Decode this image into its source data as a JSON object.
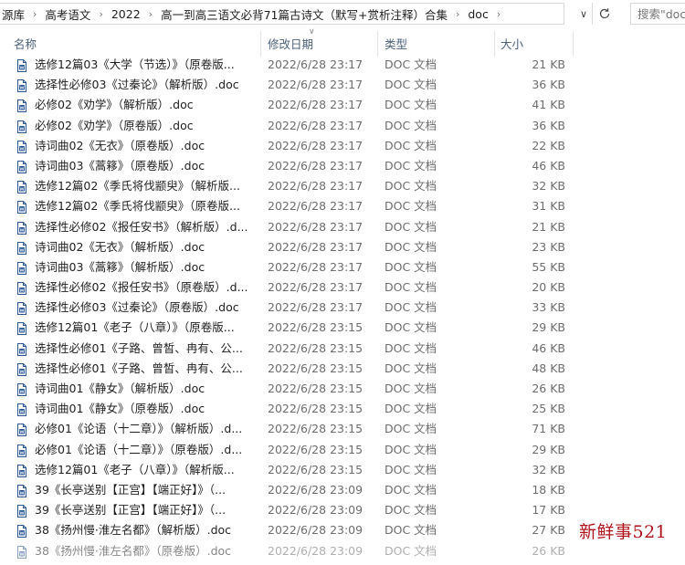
{
  "breadcrumb": [
    "源库",
    "高考语文",
    "2022",
    "高一到高三语文必背71篇古诗文（默写+赏析注释）合集",
    "doc"
  ],
  "search": {
    "placeholder": "搜索\"doc"
  },
  "columns": {
    "name": "名称",
    "date": "修改日期",
    "type": "类型",
    "size": "大小"
  },
  "files": [
    {
      "name": "选修12篇03《大学（节选）》（原卷版...",
      "date": "2022/6/28 23:17",
      "type": "DOC 文档",
      "size": "21 KB"
    },
    {
      "name": "选择性必修03《过秦论》（解析版）.doc",
      "date": "2022/6/28 23:17",
      "type": "DOC 文档",
      "size": "36 KB"
    },
    {
      "name": "必修02《劝学》（解析版）.doc",
      "date": "2022/6/28 23:17",
      "type": "DOC 文档",
      "size": "41 KB"
    },
    {
      "name": "必修02《劝学》（原卷版）.doc",
      "date": "2022/6/28 23:17",
      "type": "DOC 文档",
      "size": "36 KB"
    },
    {
      "name": "诗词曲02《无衣》（原卷版）.doc",
      "date": "2022/6/28 23:17",
      "type": "DOC 文档",
      "size": "22 KB"
    },
    {
      "name": "诗词曲03《蒿簃》（原卷版）.doc",
      "date": "2022/6/28 23:17",
      "type": "DOC 文档",
      "size": "46 KB"
    },
    {
      "name": "选修12篇02《季氏将伐颛臾》（解析版...",
      "date": "2022/6/28 23:17",
      "type": "DOC 文档",
      "size": "32 KB"
    },
    {
      "name": "选修12篇02《季氏将伐颛臾》（原卷版...",
      "date": "2022/6/28 23:17",
      "type": "DOC 文档",
      "size": "31 KB"
    },
    {
      "name": "选择性必修02《报任安书》（解析版）.d...",
      "date": "2022/6/28 23:17",
      "type": "DOC 文档",
      "size": "21 KB"
    },
    {
      "name": "诗词曲02《无衣》（解析版）.doc",
      "date": "2022/6/28 23:17",
      "type": "DOC 文档",
      "size": "23 KB"
    },
    {
      "name": "诗词曲03《蒿簃》（解析版）.doc",
      "date": "2022/6/28 23:17",
      "type": "DOC 文档",
      "size": "55 KB"
    },
    {
      "name": "选择性必修02《报任安书》（原卷版）.d...",
      "date": "2022/6/28 23:17",
      "type": "DOC 文档",
      "size": "20 KB"
    },
    {
      "name": "选择性必修03《过秦论》（原卷版）.doc",
      "date": "2022/6/28 23:17",
      "type": "DOC 文档",
      "size": "33 KB"
    },
    {
      "name": "选修12篇01《老子（八章）》（原卷版...",
      "date": "2022/6/28 23:15",
      "type": "DOC 文档",
      "size": "29 KB"
    },
    {
      "name": "选择性必修01《子路、曾皙、冉有、公...",
      "date": "2022/6/28 23:15",
      "type": "DOC 文档",
      "size": "46 KB"
    },
    {
      "name": "选择性必修01《子路、曾皙、冉有、公...",
      "date": "2022/6/28 23:15",
      "type": "DOC 文档",
      "size": "48 KB"
    },
    {
      "name": "诗词曲01《静女》（解析版）.doc",
      "date": "2022/6/28 23:15",
      "type": "DOC 文档",
      "size": "26 KB"
    },
    {
      "name": "诗词曲01《静女》（原卷版）.doc",
      "date": "2022/6/28 23:15",
      "type": "DOC 文档",
      "size": "25 KB"
    },
    {
      "name": "必修01《论语（十二章）》（解析版）.d...",
      "date": "2022/6/28 23:15",
      "type": "DOC 文档",
      "size": "71 KB"
    },
    {
      "name": "必修01《论语（十二章）》（原卷版）.d...",
      "date": "2022/6/28 23:15",
      "type": "DOC 文档",
      "size": "29 KB"
    },
    {
      "name": "选修12篇01《老子（八章）》（解析版...",
      "date": "2022/6/28 23:15",
      "type": "DOC 文档",
      "size": "32 KB"
    },
    {
      "name": "39《长亭送别【正宫】【端正好】》（...",
      "date": "2022/6/28 23:09",
      "type": "DOC 文档",
      "size": "18 KB"
    },
    {
      "name": "39《长亭送别【正宫】【端正好】》（...",
      "date": "2022/6/28 23:09",
      "type": "DOC 文档",
      "size": "17 KB"
    },
    {
      "name": "38《扬州慢·淮左名都》（解析版）.doc",
      "date": "2022/6/28 23:09",
      "type": "DOC 文档",
      "size": "27 KB"
    },
    {
      "name": "38《扬州慢·淮左名都》（原卷版）.doc",
      "date": "2022/6/28 23:09",
      "type": "DOC 文档",
      "size": "26 KB"
    }
  ],
  "watermark": "新鲜事521",
  "icons": {
    "file": "word-doc-icon",
    "dropdown": "chevron-down-icon",
    "refresh": "refresh-icon",
    "separator": "chevron-right-icon"
  },
  "colors": {
    "header_text": "#4c607a",
    "icon_blue": "#2b5797",
    "watermark": "#b0131c"
  }
}
